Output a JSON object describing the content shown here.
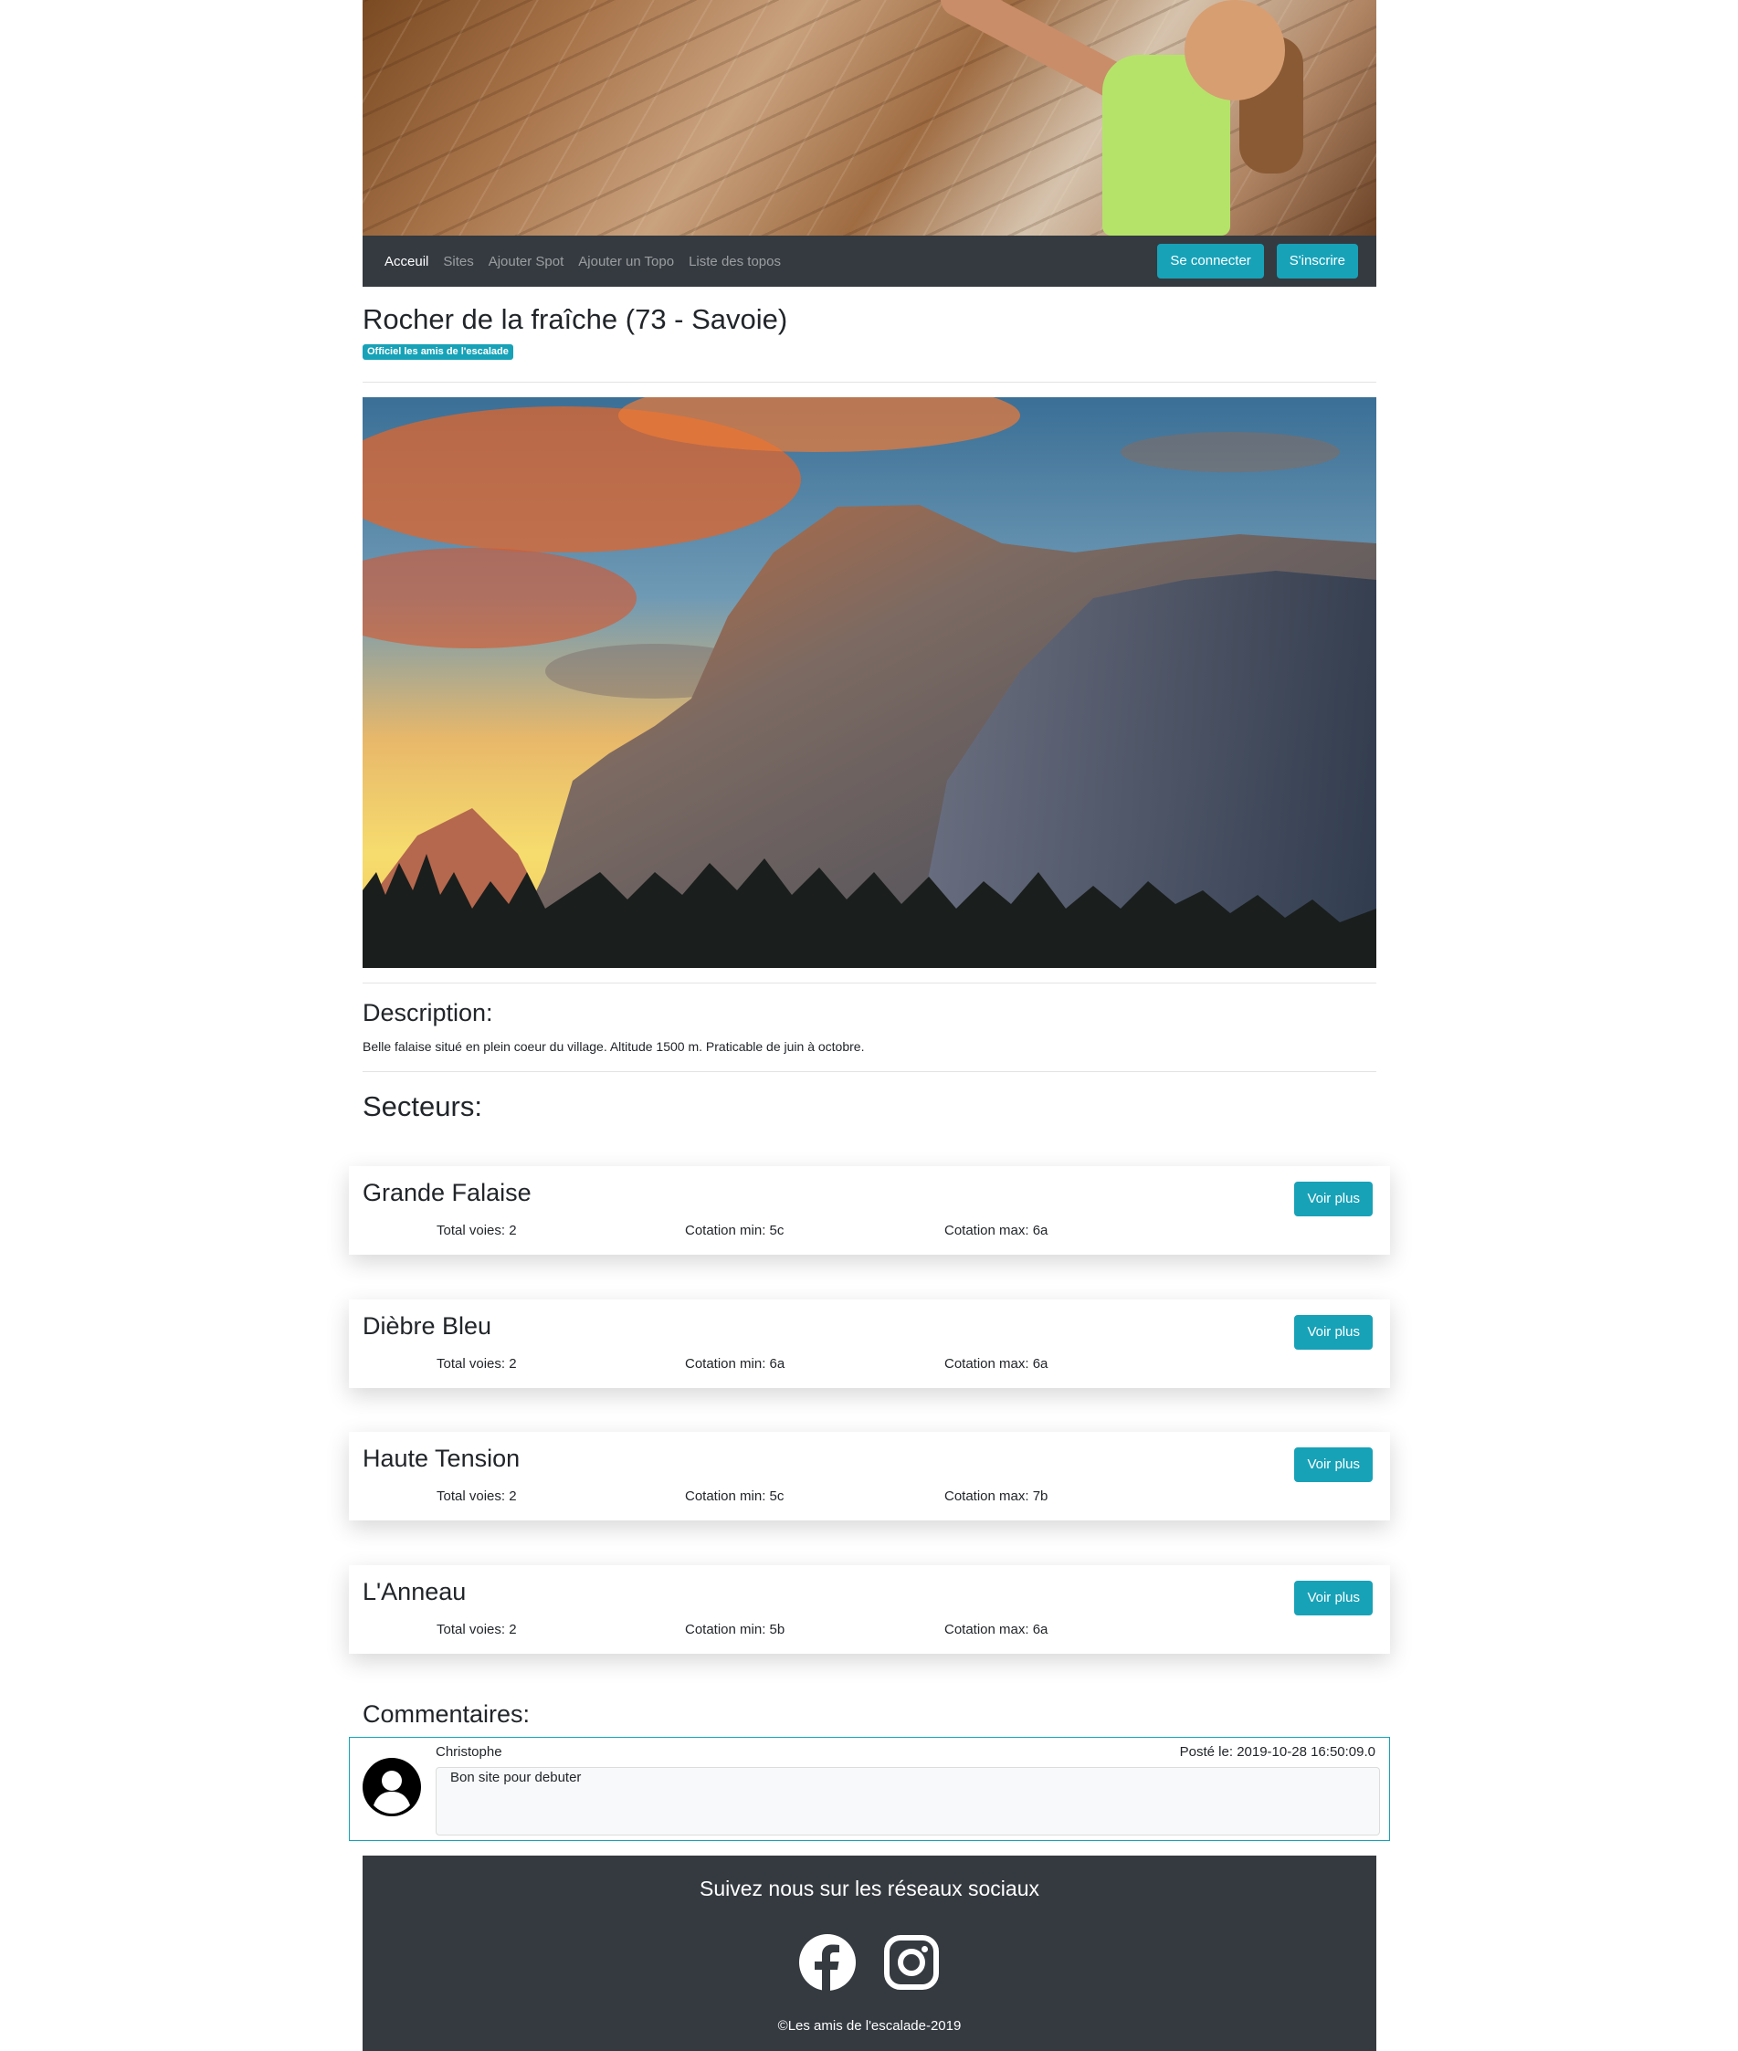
{
  "nav": {
    "items": [
      "Acceuil",
      "Sites",
      "Ajouter Spot",
      "Ajouter un Topo",
      "Liste des topos"
    ],
    "login_label": "Se connecter",
    "signup_label": "S'inscrire"
  },
  "site": {
    "title": "Rocher de la fraîche (73 - Savoie)",
    "badge": "Officiel les amis de l'escalade"
  },
  "description": {
    "heading": "Description:",
    "text": "Belle falaise situé en plein coeur du village. Altitude 1500 m. Praticable de juin à octobre."
  },
  "sectors": {
    "heading": "Secteurs:",
    "button_label": "Voir plus",
    "items": [
      {
        "name": "Grande Falaise",
        "total": "Total voies: 2",
        "min": "Cotation min: 5c",
        "max": "Cotation max: 6a"
      },
      {
        "name": "Dièbre Bleu",
        "total": "Total voies: 2",
        "min": "Cotation min: 6a",
        "max": "Cotation max: 6a"
      },
      {
        "name": "Haute Tension",
        "total": "Total voies: 2",
        "min": "Cotation min: 5c",
        "max": "Cotation max: 7b"
      },
      {
        "name": "L'Anneau",
        "total": "Total voies: 2",
        "min": "Cotation min: 5b",
        "max": "Cotation max: 6a"
      }
    ]
  },
  "comments": {
    "heading": "Commentaires:",
    "items": [
      {
        "author": "Christophe",
        "date": "Posté le: 2019-10-28 16:50:09.0",
        "text": "Bon site pour debuter"
      }
    ]
  },
  "footer": {
    "title": "Suivez nous sur les réseaux sociaux",
    "copyright": "©Les amis de l'escalade-2019",
    "icons": [
      "facebook-icon",
      "instagram-icon"
    ]
  },
  "colors": {
    "accent": "#17a2b8",
    "dark": "#343a40"
  }
}
